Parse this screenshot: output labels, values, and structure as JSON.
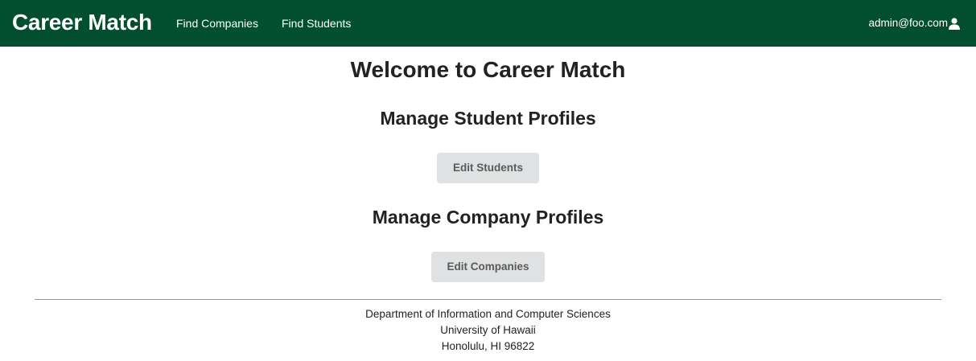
{
  "navbar": {
    "brand": "Career Match",
    "links": [
      {
        "label": "Find Companies"
      },
      {
        "label": "Find Students"
      }
    ],
    "user_email": "admin@foo.com",
    "background_color": "#024f30"
  },
  "main": {
    "title": "Welcome to Career Match",
    "sections": [
      {
        "heading": "Manage Student Profiles",
        "button_label": "Edit Students"
      },
      {
        "heading": "Manage Company Profiles",
        "button_label": "Edit Companies"
      }
    ]
  },
  "footer": {
    "lines": [
      "Department of Information and Computer Sciences",
      "University of Hawaii",
      "Honolulu, HI 96822"
    ]
  }
}
